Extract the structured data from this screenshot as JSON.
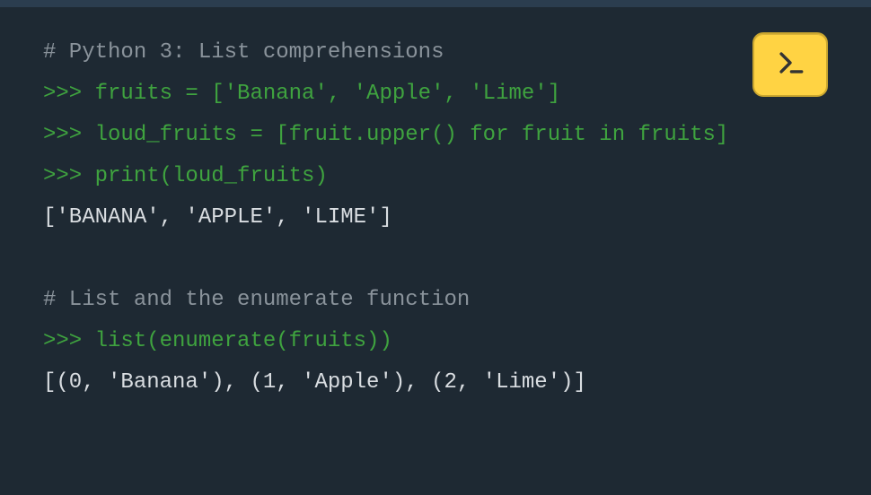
{
  "console": {
    "lines": [
      {
        "type": "comment",
        "text": "# Python 3: List comprehensions",
        "prompt": ""
      },
      {
        "type": "input",
        "text": "fruits = ['Banana', 'Apple', 'Lime']",
        "prompt": ">>> "
      },
      {
        "type": "input",
        "text": "loud_fruits = [fruit.upper() for fruit in fruits]",
        "prompt": ">>> "
      },
      {
        "type": "input",
        "text": "print(loud_fruits)",
        "prompt": ">>> "
      },
      {
        "type": "output",
        "text": "['BANANA', 'APPLE', 'LIME']",
        "prompt": ""
      },
      {
        "type": "blank",
        "text": "",
        "prompt": ""
      },
      {
        "type": "comment",
        "text": "# List and the enumerate function",
        "prompt": ""
      },
      {
        "type": "input",
        "text": "list(enumerate(fruits))",
        "prompt": ">>> "
      },
      {
        "type": "output",
        "text": "[(0, 'Banana'), (1, 'Apple'), (2, 'Lime')]",
        "prompt": ""
      }
    ],
    "launch_label": "Launch interactive shell"
  },
  "colors": {
    "bg": "#1e2933",
    "accent": "#ffd343",
    "comment": "#8a939b",
    "code": "#3fa33f",
    "output": "#d9dde1"
  }
}
